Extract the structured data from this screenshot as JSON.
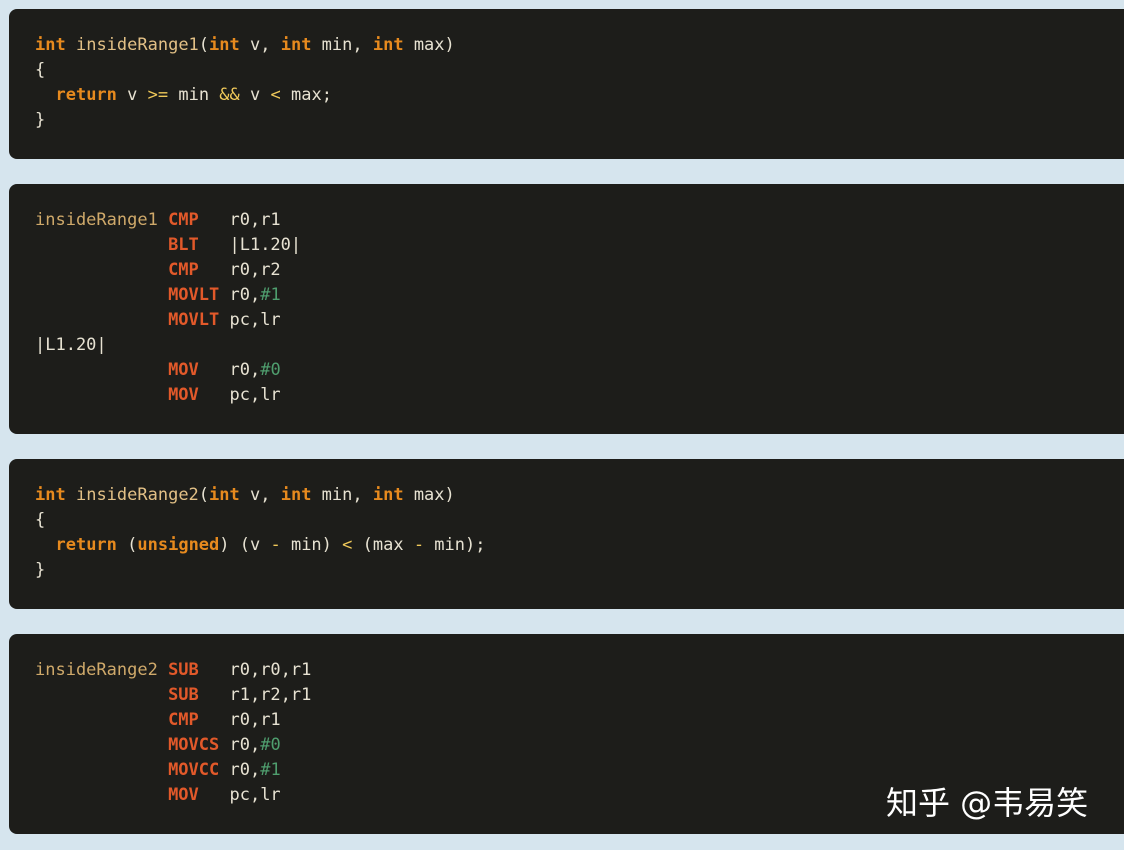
{
  "colors": {
    "page_background": "#d6e5ee",
    "code_background": "#1d1d1a",
    "keyword": "#e78a1e",
    "function_name": "#e2c086",
    "identifier": "#e7e2d2",
    "operator": "#f0c95a",
    "asm_label": "#cfa96a",
    "asm_instruction": "#e2592a",
    "asm_immediate": "#4f9e6e",
    "watermark": "#ffffff"
  },
  "code_blocks": [
    {
      "language": "c",
      "lines": [
        [
          {
            "t": "int",
            "k": "kw"
          },
          {
            "t": " ",
            "k": "pun"
          },
          {
            "t": "insideRange1",
            "k": "fn"
          },
          {
            "t": "(",
            "k": "pun"
          },
          {
            "t": "int",
            "k": "kw"
          },
          {
            "t": " v, ",
            "k": "var"
          },
          {
            "t": "int",
            "k": "kw"
          },
          {
            "t": " min, ",
            "k": "var"
          },
          {
            "t": "int",
            "k": "kw"
          },
          {
            "t": " max",
            "k": "var"
          },
          {
            "t": ")",
            "k": "pun"
          }
        ],
        [
          {
            "t": "{",
            "k": "pun"
          }
        ],
        [
          {
            "t": "  ",
            "k": "pun"
          },
          {
            "t": "return",
            "k": "kw"
          },
          {
            "t": " v ",
            "k": "var"
          },
          {
            "t": ">=",
            "k": "op"
          },
          {
            "t": " min ",
            "k": "var"
          },
          {
            "t": "&&",
            "k": "op"
          },
          {
            "t": " v ",
            "k": "var"
          },
          {
            "t": "<",
            "k": "op"
          },
          {
            "t": " max;",
            "k": "var"
          }
        ],
        [
          {
            "t": "}",
            "k": "pun"
          }
        ]
      ]
    },
    {
      "language": "asm",
      "lines": [
        [
          {
            "t": "insideRange1 ",
            "k": "lbl"
          },
          {
            "t": "CMP  ",
            "k": "ins"
          },
          {
            "t": " r0,r1",
            "k": "reg"
          }
        ],
        [
          {
            "t": "             ",
            "k": "pun"
          },
          {
            "t": "BLT  ",
            "k": "ins"
          },
          {
            "t": " |L1.20|",
            "k": "reg"
          }
        ],
        [
          {
            "t": "             ",
            "k": "pun"
          },
          {
            "t": "CMP  ",
            "k": "ins"
          },
          {
            "t": " r0,r2",
            "k": "reg"
          }
        ],
        [
          {
            "t": "             ",
            "k": "pun"
          },
          {
            "t": "MOVLT",
            "k": "ins"
          },
          {
            "t": " r0,",
            "k": "reg"
          },
          {
            "t": "#1",
            "k": "imm"
          }
        ],
        [
          {
            "t": "             ",
            "k": "pun"
          },
          {
            "t": "MOVLT",
            "k": "ins"
          },
          {
            "t": " pc,lr",
            "k": "reg"
          }
        ],
        [
          {
            "t": "|L1.20|",
            "k": "reg"
          }
        ],
        [
          {
            "t": "             ",
            "k": "pun"
          },
          {
            "t": "MOV  ",
            "k": "ins"
          },
          {
            "t": " r0,",
            "k": "reg"
          },
          {
            "t": "#0",
            "k": "imm"
          }
        ],
        [
          {
            "t": "             ",
            "k": "pun"
          },
          {
            "t": "MOV  ",
            "k": "ins"
          },
          {
            "t": " pc,lr",
            "k": "reg"
          }
        ]
      ]
    },
    {
      "language": "c",
      "lines": [
        [
          {
            "t": "int",
            "k": "kw"
          },
          {
            "t": " ",
            "k": "pun"
          },
          {
            "t": "insideRange2",
            "k": "fn"
          },
          {
            "t": "(",
            "k": "pun"
          },
          {
            "t": "int",
            "k": "kw"
          },
          {
            "t": " v, ",
            "k": "var"
          },
          {
            "t": "int",
            "k": "kw"
          },
          {
            "t": " min, ",
            "k": "var"
          },
          {
            "t": "int",
            "k": "kw"
          },
          {
            "t": " max",
            "k": "var"
          },
          {
            "t": ")",
            "k": "pun"
          }
        ],
        [
          {
            "t": "{",
            "k": "pun"
          }
        ],
        [
          {
            "t": "  ",
            "k": "pun"
          },
          {
            "t": "return",
            "k": "kw"
          },
          {
            "t": " (",
            "k": "var"
          },
          {
            "t": "unsigned",
            "k": "kw"
          },
          {
            "t": ") (v ",
            "k": "var"
          },
          {
            "t": "-",
            "k": "op"
          },
          {
            "t": " min) ",
            "k": "var"
          },
          {
            "t": "<",
            "k": "op"
          },
          {
            "t": " (max ",
            "k": "var"
          },
          {
            "t": "-",
            "k": "op"
          },
          {
            "t": " min);",
            "k": "var"
          }
        ],
        [
          {
            "t": "}",
            "k": "pun"
          }
        ]
      ]
    },
    {
      "language": "asm",
      "lines": [
        [
          {
            "t": "insideRange2 ",
            "k": "lbl"
          },
          {
            "t": "SUB  ",
            "k": "ins"
          },
          {
            "t": " r0,r0,r1",
            "k": "reg"
          }
        ],
        [
          {
            "t": "             ",
            "k": "pun"
          },
          {
            "t": "SUB  ",
            "k": "ins"
          },
          {
            "t": " r1,r2,r1",
            "k": "reg"
          }
        ],
        [
          {
            "t": "             ",
            "k": "pun"
          },
          {
            "t": "CMP  ",
            "k": "ins"
          },
          {
            "t": " r0,r1",
            "k": "reg"
          }
        ],
        [
          {
            "t": "             ",
            "k": "pun"
          },
          {
            "t": "MOVCS",
            "k": "ins"
          },
          {
            "t": " r0,",
            "k": "reg"
          },
          {
            "t": "#0",
            "k": "imm"
          }
        ],
        [
          {
            "t": "             ",
            "k": "pun"
          },
          {
            "t": "MOVCC",
            "k": "ins"
          },
          {
            "t": " r0,",
            "k": "reg"
          },
          {
            "t": "#1",
            "k": "imm"
          }
        ],
        [
          {
            "t": "             ",
            "k": "pun"
          },
          {
            "t": "MOV  ",
            "k": "ins"
          },
          {
            "t": " pc,lr",
            "k": "reg"
          }
        ]
      ]
    }
  ],
  "watermark": {
    "text": "知乎 @韦易笑"
  }
}
